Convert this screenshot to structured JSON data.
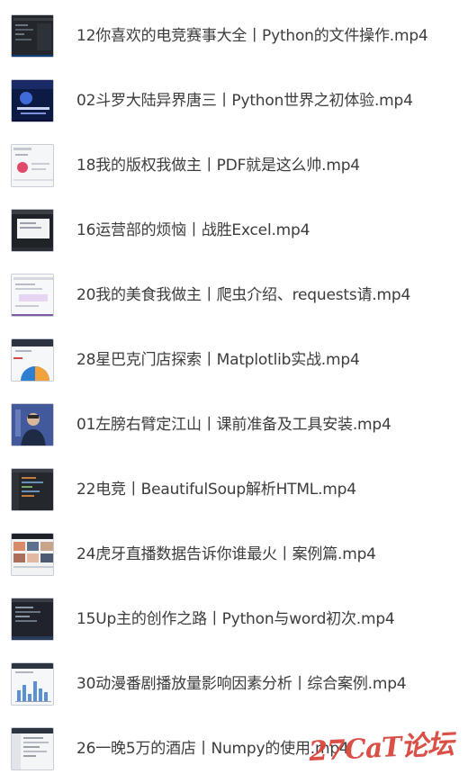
{
  "files": [
    {
      "name": "12你喜欢的电竞赛事大全丨Python的文件操作.mp4",
      "thumbnail": "video-thumbnail-dark-code-editor"
    },
    {
      "name": "02斗罗大陆异界唐三丨Python世界之初体验.mp4",
      "thumbnail": "video-thumbnail-blue-game-scene"
    },
    {
      "name": "18我的版权我做主丨PDF就是这么帅.mp4",
      "thumbnail": "video-thumbnail-white-document"
    },
    {
      "name": "16运营部的烦恼丨战胜Excel.mp4",
      "thumbnail": "video-thumbnail-dark-window"
    },
    {
      "name": "20我的美食我做主丨爬虫介绍、requests请.mp4",
      "thumbnail": "video-thumbnail-white-webpage"
    },
    {
      "name": "28星巴克门店探索丨Matplotlib实战.mp4",
      "thumbnail": "video-thumbnail-pie-chart"
    },
    {
      "name": "01左膀右臂定江山丨课前准备及工具安装.mp4",
      "thumbnail": "video-thumbnail-presenter"
    },
    {
      "name": "22电竞丨BeautifulSoup解析HTML.mp4",
      "thumbnail": "video-thumbnail-dark-code-editor"
    },
    {
      "name": "24虎牙直播数据告诉你谁最火丨案例篇.mp4",
      "thumbnail": "video-thumbnail-live-stream-grid"
    },
    {
      "name": "15Up主的创作之路丨Python与word初次.mp4",
      "thumbnail": "video-thumbnail-dark-code-editor"
    },
    {
      "name": "30动漫番剧播放量影响因素分析丨综合案例.mp4",
      "thumbnail": "video-thumbnail-bar-chart"
    },
    {
      "name": "26一晚5万的酒店丨Numpy的使用.mp4",
      "thumbnail": "video-thumbnail-white-editor"
    }
  ],
  "watermark": {
    "text": "27CaT论坛",
    "color": "#d9463d"
  }
}
